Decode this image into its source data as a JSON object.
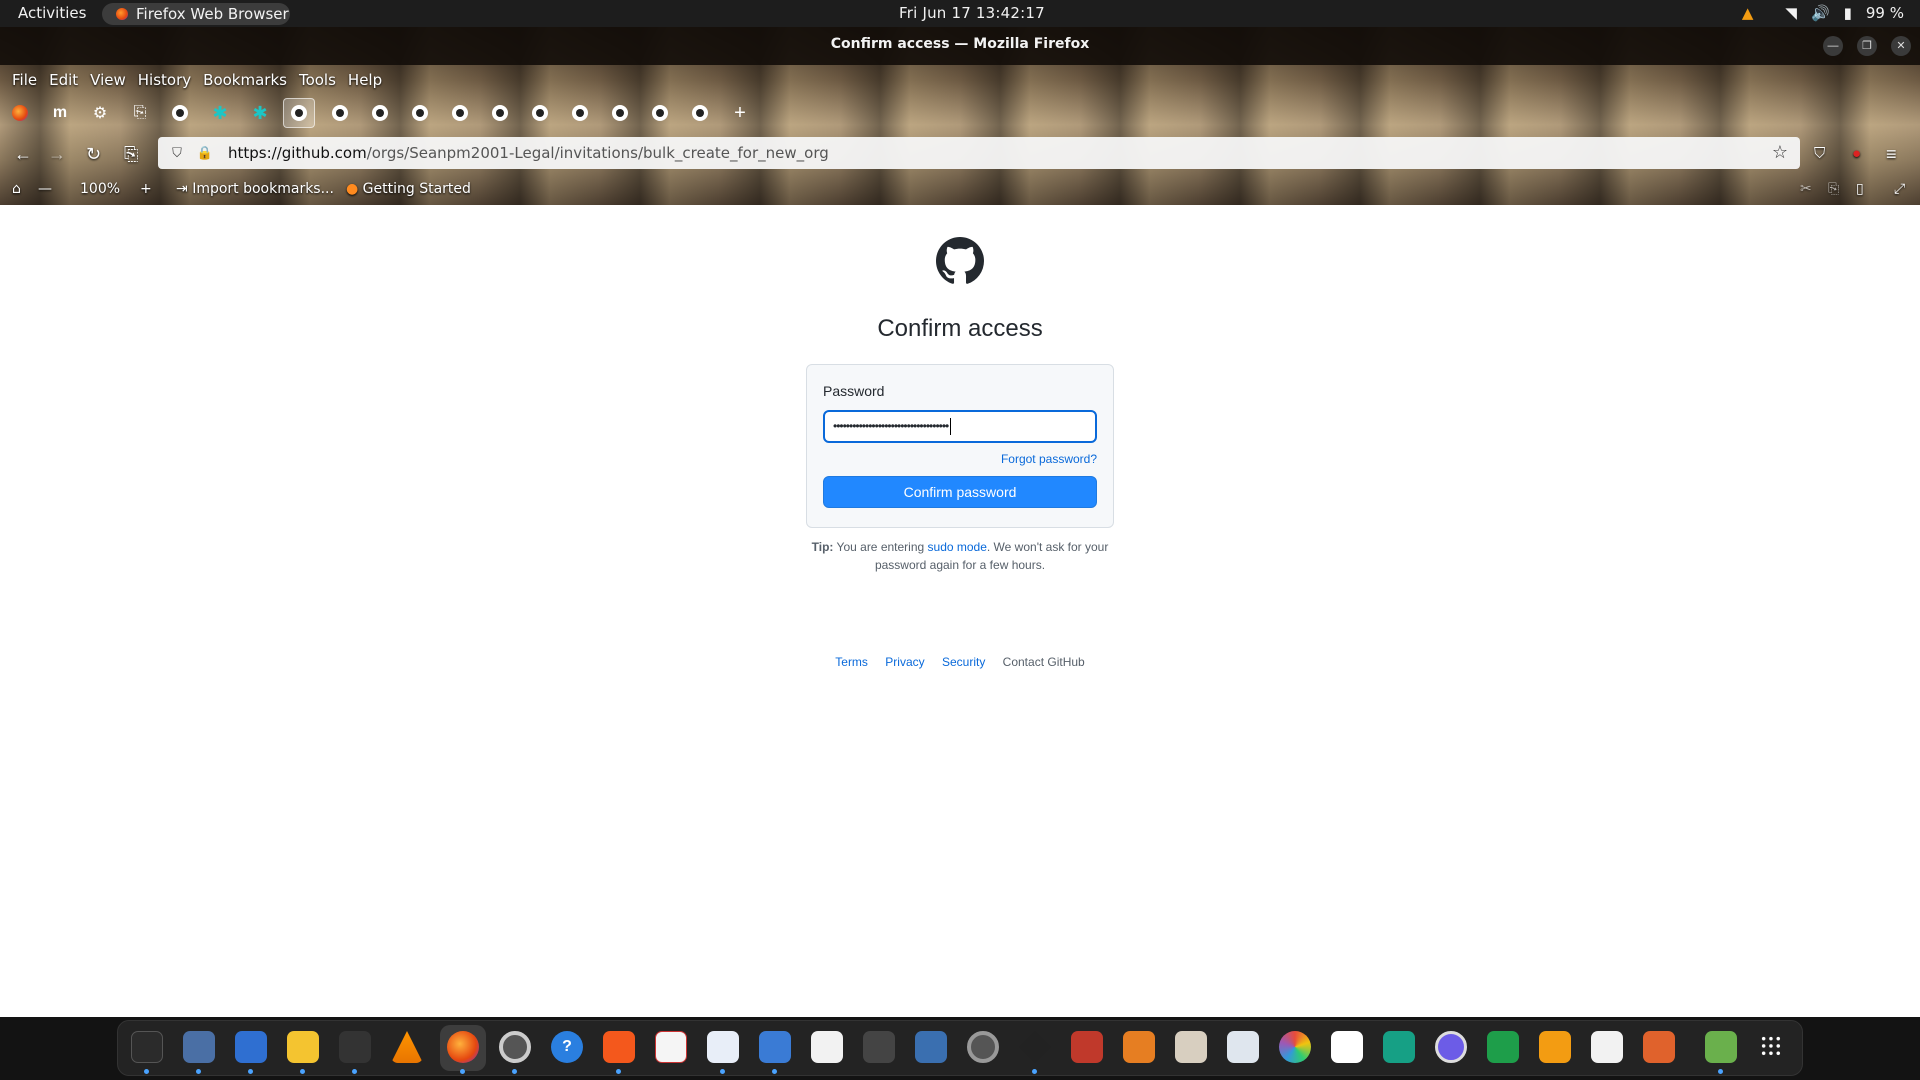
{
  "topbar": {
    "activities": "Activities",
    "app_name": "Firefox Web Browser",
    "clock": "Fri Jun 17  13:42:17",
    "battery": "99 %"
  },
  "window": {
    "title": "Confirm access — Mozilla Firefox"
  },
  "menu": [
    "File",
    "Edit",
    "View",
    "History",
    "Bookmarks",
    "Tools",
    "Help"
  ],
  "tabs": {
    "icons": [
      "firefox-icon",
      "m-icon",
      "gear-icon",
      "puzzle-icon",
      "github-icon",
      "teal-x-icon",
      "teal-x-icon",
      "github-icon",
      "github-icon",
      "github-icon",
      "github-icon",
      "github-icon",
      "github-icon",
      "github-icon",
      "github-icon",
      "github-icon",
      "github-icon",
      "github-icon"
    ],
    "active_index": 7,
    "new_tab": "+"
  },
  "nav": {
    "url_host": "https://github.com",
    "url_path": "/orgs/Seanpm2001-Legal/invitations/bulk_create_for_new_org"
  },
  "bookmarks": {
    "zoom": "100%",
    "import": "Import bookmarks...",
    "getting_started": "Getting Started"
  },
  "page": {
    "title": "Confirm access",
    "password_label": "Password",
    "password_value": "••••••••••••••••••••••••••••••••••••",
    "forgot_link": "Forgot password?",
    "confirm_button": "Confirm password",
    "tip_label": "Tip:",
    "tip_text_1": " You are entering ",
    "tip_link": "sudo mode",
    "tip_text_2": ". We won't ask for your password again for a few hours.",
    "footer": {
      "terms": "Terms",
      "privacy": "Privacy",
      "security": "Security",
      "contact": "Contact GitHub"
    }
  },
  "colors": {
    "accent_blue": "#2188ff",
    "link_blue": "#0969da",
    "dock_indicator": "#4aa3ff"
  },
  "dock": {
    "apps": [
      "system-monitor-icon",
      "files-icon",
      "writer-icon",
      "notes-icon",
      "terminal-icon",
      "vlc-icon",
      "firefox-icon",
      "settings-icon",
      "help-icon",
      "software-center-icon",
      "graph-icon",
      "text-editor-icon",
      "scanner-icon",
      "document-icon",
      "ai-bot-icon",
      "virtualbox-icon",
      "camera-icon",
      "inkscape-icon",
      "game-icon",
      "mario-icon",
      "archive-icon",
      "image-viewer-icon",
      "color-picker-icon",
      "book-icon",
      "teal-app-icon",
      "screen-record-icon",
      "calc-icon",
      "impress-icon",
      "math-icon",
      "presentation-icon",
      "trash-icon",
      "app-grid-icon"
    ]
  }
}
